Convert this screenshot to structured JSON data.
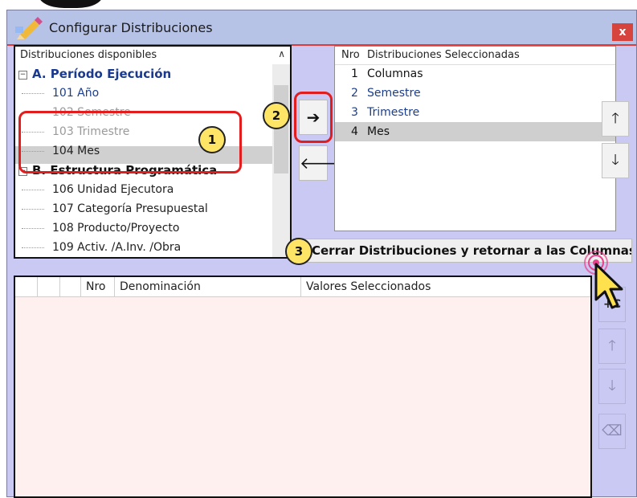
{
  "window": {
    "title": "Configurar Distribuciones",
    "close_label": "x"
  },
  "available": {
    "header": "Distribuciones disponibles",
    "groups": [
      {
        "label": "A. Período Ejecución",
        "toggle": "−"
      },
      {
        "label": "B. Estructura Programática",
        "toggle": "−"
      }
    ],
    "items": [
      {
        "label": "101 Año"
      },
      {
        "label": "102 Semestre"
      },
      {
        "label": "103 Trimestre"
      },
      {
        "label": "104 Mes"
      },
      {
        "label": "106 Unidad Ejecutora"
      },
      {
        "label": "107 Categoría Presupuestal"
      },
      {
        "label": "108 Producto/Proyecto"
      },
      {
        "label": "109 Activ. /A.Inv. /Obra"
      }
    ]
  },
  "selected": {
    "header_nro": "Nro",
    "header_name": "Distribuciones Seleccionadas",
    "items": [
      {
        "nro": "1",
        "name": "Columnas"
      },
      {
        "nro": "2",
        "name": "Semestre"
      },
      {
        "nro": "3",
        "name": "Trimestre"
      },
      {
        "nro": "4",
        "name": "Mes"
      }
    ]
  },
  "buttons": {
    "move_right": "➔",
    "move_left": "🡐",
    "move_up": "🡑",
    "move_down": "🡓",
    "close_distributions": "Cerrar Distribuciones y retornar a las Columnas",
    "add_column": "+C",
    "grid_up": "🡑",
    "grid_down": "🡓",
    "grid_erase": "⌫"
  },
  "grid": {
    "columns": [
      "",
      "",
      "",
      "Nro",
      "Denominación",
      "Valores Seleccionados"
    ]
  },
  "annotations": {
    "badge1": "1",
    "badge2": "2",
    "badge3": "3"
  }
}
